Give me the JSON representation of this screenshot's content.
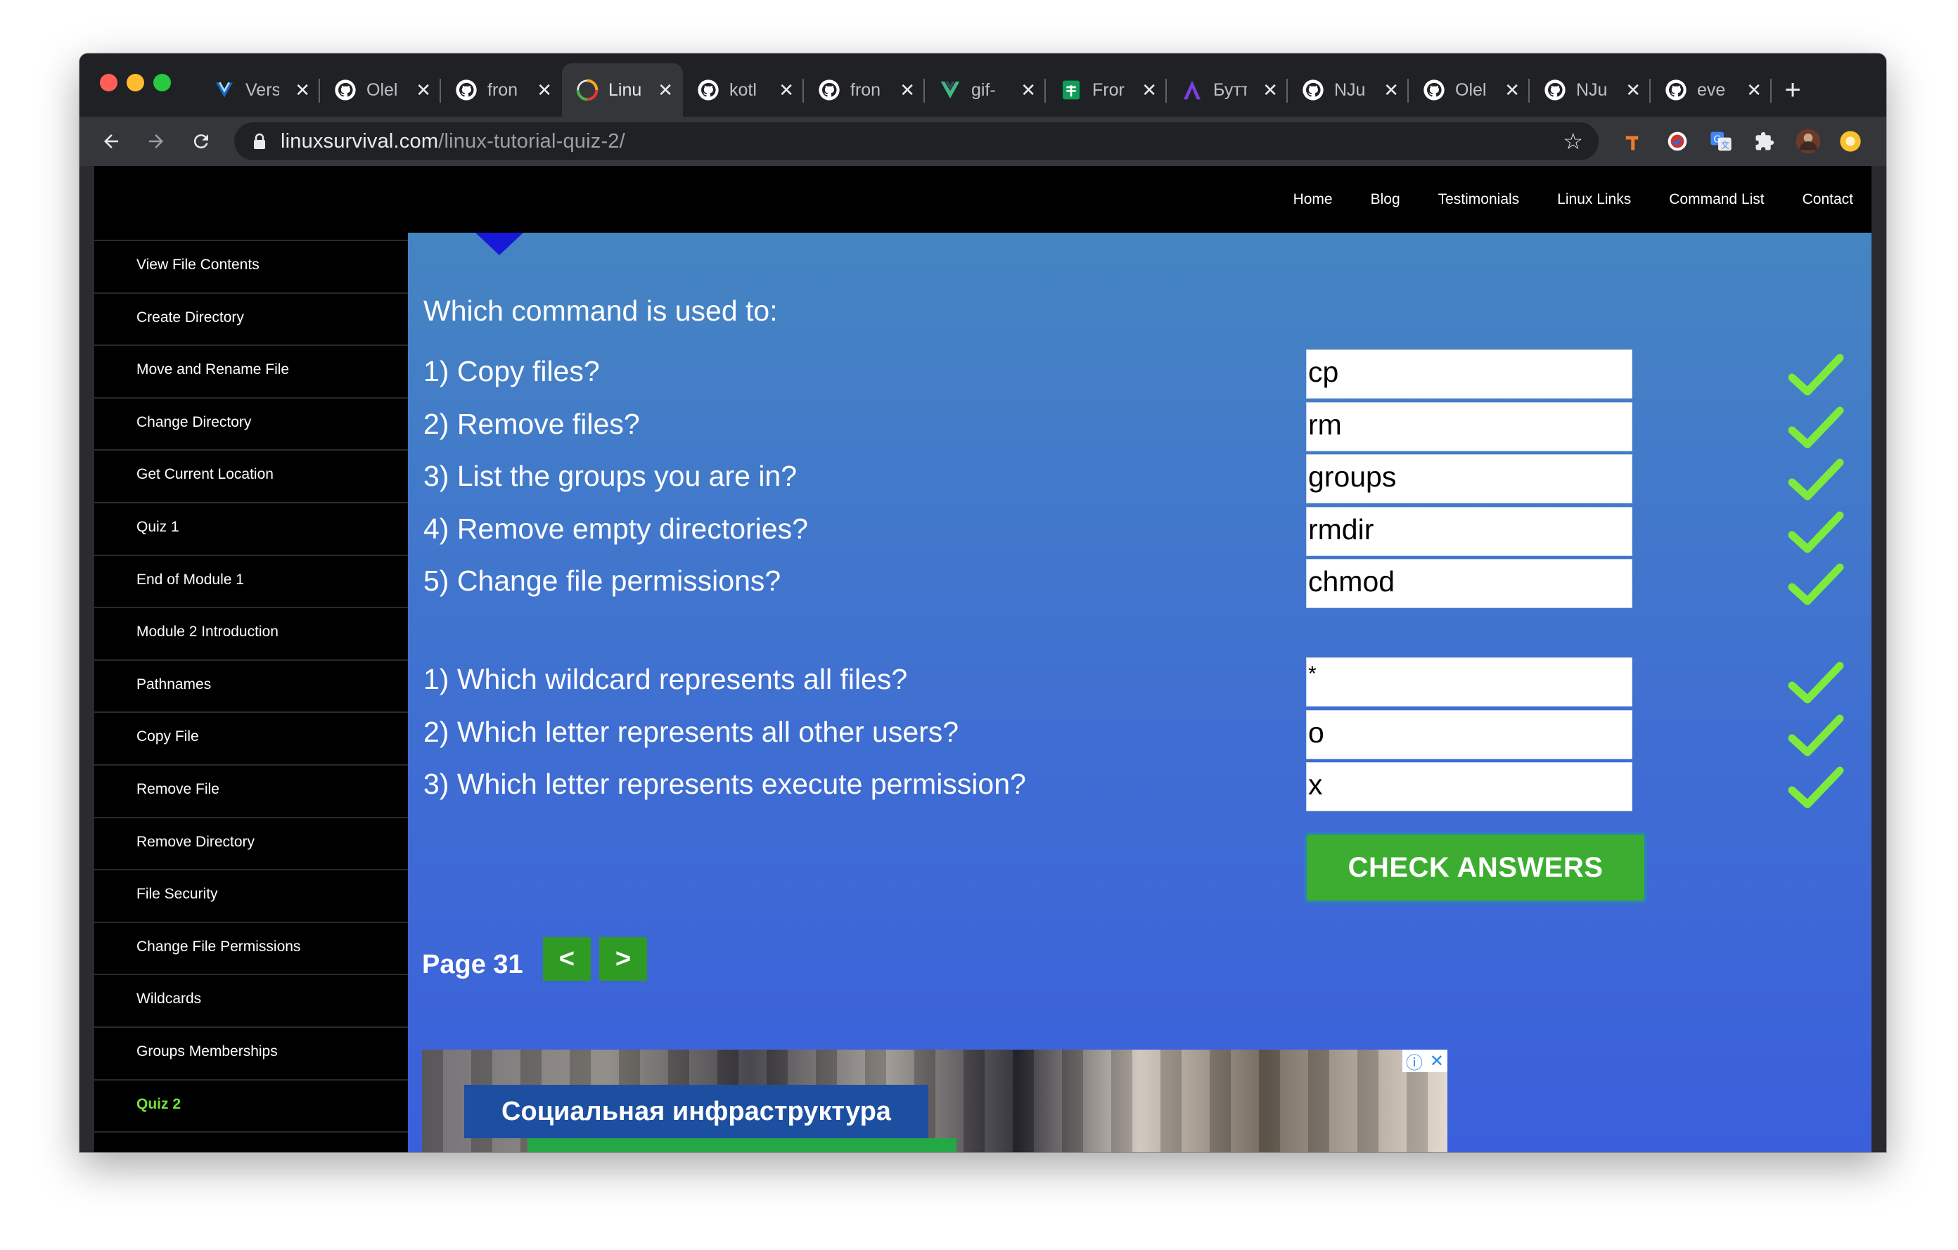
{
  "browser": {
    "tabs": [
      {
        "title": "Vers",
        "icon": "vuetify-icon"
      },
      {
        "title": "Olel",
        "icon": "github-icon"
      },
      {
        "title": "fron",
        "icon": "github-icon"
      },
      {
        "title": "Linu",
        "icon": "linux-survival-icon",
        "active": true
      },
      {
        "title": "kotl",
        "icon": "github-icon"
      },
      {
        "title": "fron",
        "icon": "github-icon"
      },
      {
        "title": "gif-",
        "icon": "vue-icon"
      },
      {
        "title": "Fror",
        "icon": "sheets-icon"
      },
      {
        "title": "Бутт",
        "icon": "a-logo-icon"
      },
      {
        "title": "NJu",
        "icon": "github-icon"
      },
      {
        "title": "Olel",
        "icon": "github-icon"
      },
      {
        "title": "NJu",
        "icon": "github-icon"
      },
      {
        "title": "eve",
        "icon": "github-icon"
      }
    ],
    "tab_close": "✕",
    "new_tab": "+",
    "url_domain": "linuxsurvival.com",
    "url_path": "/linux-tutorial-quiz-2/"
  },
  "site": {
    "nav": [
      "Home",
      "Blog",
      "Testimonials",
      "Linux Links",
      "Command List",
      "Contact"
    ],
    "sidebar": [
      "View File Contents",
      "Create Directory",
      "Move and Rename File",
      "Change Directory",
      "Get Current Location",
      "Quiz 1",
      "End of Module 1",
      "Module 2 Introduction",
      "Pathnames",
      "Copy File",
      "Remove File",
      "Remove Directory",
      "File Security",
      "Change File Permissions",
      "Wildcards",
      "Groups Memberships",
      "Quiz 2"
    ],
    "sidebar_current": "Quiz 2"
  },
  "quiz": {
    "heading": "Which command is used to:",
    "section1": [
      {
        "question": "1) Copy files?",
        "answer": "cp"
      },
      {
        "question": "2) Remove files?",
        "answer": "rm"
      },
      {
        "question": "3) List the groups you are in?",
        "answer": "groups"
      },
      {
        "question": "4) Remove empty directories?",
        "answer": "rmdir"
      },
      {
        "question": "5) Change file permissions?",
        "answer": "chmod"
      }
    ],
    "section2": [
      {
        "question": "1) Which wildcard represents all files?",
        "answer": "*"
      },
      {
        "question": "2) Which letter represents all other users?",
        "answer": "o"
      },
      {
        "question": "3) Which letter represents execute permission?",
        "answer": "x"
      }
    ],
    "check_button": "CHECK ANSWERS",
    "page_label": "Page 31",
    "prev": "<",
    "next": ">"
  },
  "ad": {
    "banner_text": "Социальная инфраструктура",
    "info": "ⓘ",
    "close": "✕"
  },
  "colors": {
    "content_gradient_top": "#4585c2",
    "content_gradient_bottom": "#3b5fdc",
    "check_green": "#3dad31",
    "tick_green": "#7dea3c",
    "current_sidebar": "#72e23a"
  }
}
